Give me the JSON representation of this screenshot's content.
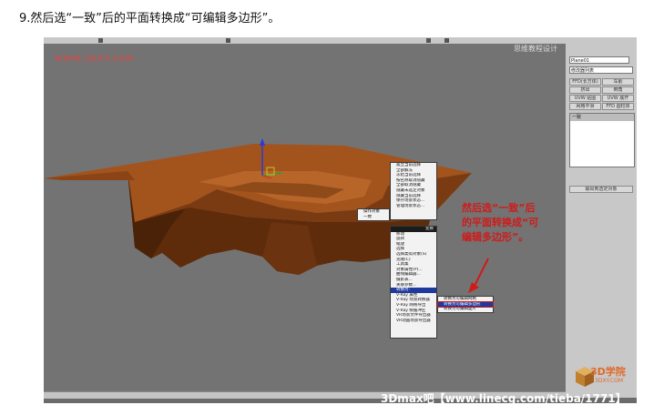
{
  "caption": "9.然后选“一致”后的平面转换成“可编辑多边形”。",
  "viewport": {
    "site_label": "WWW.3DXY.COM",
    "top_right_text": "思维教程设计"
  },
  "command_panel": {
    "object_name": "Plane01",
    "modifier_list": "修改器列表",
    "buttons": [
      "FFD(长方体)",
      "车削",
      "挤出",
      "倒角",
      "UVW 贴图",
      "UVW 展开",
      "网格平滑",
      "FFD 圆柱体"
    ],
    "stack_header": "一致",
    "pin_button": "输出到选定对象"
  },
  "context_menu_upper": {
    "items": [
      "孤立当前选择",
      "全部解冻",
      "冻结当前选择",
      "按名称取消隐藏",
      "全部取消隐藏",
      "隐藏未选定对象",
      "隐藏当前选择",
      "保存场景状态...",
      "管理场景状态..."
    ],
    "left_items": [
      "操作对象",
      "一致",
      "✓"
    ]
  },
  "context_menu_lower": {
    "header": "变换",
    "items": [
      "移动",
      "旋转",
      "缩放",
      "选择",
      "选择类似对象(S)",
      "克隆(C)",
      "工具集",
      "对象属性(P)...",
      "曲线编辑器...",
      "摄影表...",
      "关联参数...",
      "转换为:",
      "V-Ray 属性",
      "V-Ray 场景转换器",
      "V-Ray 网格导出",
      "V-Ray 帧缓冲区",
      "VR场景文件导出器",
      "VR动画场景导出器"
    ],
    "highlighted_index": 11
  },
  "submenu": {
    "items": [
      "转换为可编辑网格",
      "转换为可编辑多边形",
      "转换为可编辑面片"
    ],
    "highlighted_index": 1
  },
  "annotation": {
    "lines": [
      "然后选“一致”后",
      "的平面转换成“可",
      "编辑多边形”。"
    ]
  },
  "watermark": "3Dmax吧【www.linecg.com/tieba/1771】",
  "logo": {
    "name": "3D学院",
    "sub": "3DXY.COM"
  },
  "colors": {
    "terrain_top": "#a3531c",
    "terrain_side": "#5e2c0b",
    "annotation": "#d11a1a",
    "menu_highlight": "#1f3a9e"
  }
}
